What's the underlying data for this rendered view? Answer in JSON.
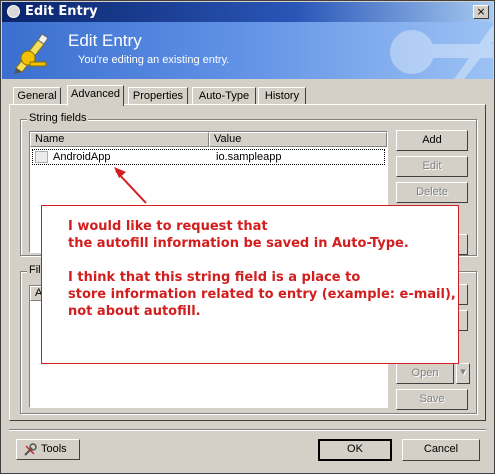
{
  "window": {
    "title": "Edit Entry",
    "close_glyph": "×"
  },
  "banner": {
    "title": "Edit Entry",
    "subtitle": "You're editing an existing entry.",
    "icon": "keys-pen-icon"
  },
  "tabs": [
    {
      "label": "General",
      "active": false
    },
    {
      "label": "Advanced",
      "active": true
    },
    {
      "label": "Properties",
      "active": false
    },
    {
      "label": "Auto-Type",
      "active": false
    },
    {
      "label": "History",
      "active": false
    }
  ],
  "string_fields": {
    "label": "String fields",
    "columns": [
      "Name",
      "Value"
    ],
    "rows": [
      {
        "name": "AndroidApp",
        "value": "io.sampleapp"
      }
    ],
    "buttons": {
      "add": "Add",
      "edit": "Edit",
      "delete": "Delete"
    }
  },
  "file_attachments": {
    "label_partial": "Fil",
    "column_partial": "A",
    "buttons": {
      "open": "Open",
      "save": "Save"
    }
  },
  "annotation": {
    "line1": "I would like to request that",
    "line2": "the autofill information be saved in Auto-Type.",
    "line3": "I think that this string field is a place to",
    "line4": "store information related to entry (example: e-mail),",
    "line5": "not about autofill.",
    "color": "#d21e1e"
  },
  "footer": {
    "tools": "Tools",
    "ok": "OK",
    "cancel": "Cancel"
  },
  "colors": {
    "title_bar": "#0a246a",
    "banner": "#3b6fcf",
    "face": "#d4d0c8"
  }
}
